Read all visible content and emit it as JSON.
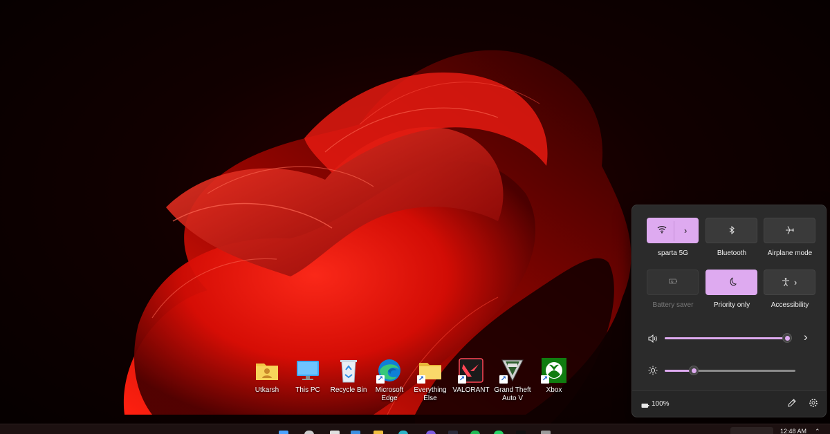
{
  "desktop": {
    "icons": [
      {
        "label": "Utkarsh",
        "icon": "user-folder-icon",
        "shortcut": false
      },
      {
        "label": "This PC",
        "icon": "monitor-icon",
        "shortcut": false
      },
      {
        "label": "Recycle Bin",
        "icon": "recycle-bin-icon",
        "shortcut": false
      },
      {
        "label": "Microsoft Edge",
        "icon": "edge-icon",
        "shortcut": true
      },
      {
        "label": "Everything Else",
        "icon": "folder-icon",
        "shortcut": true
      },
      {
        "label": "VALORANT",
        "icon": "valorant-icon",
        "shortcut": true
      },
      {
        "label": "Grand Theft Auto V",
        "icon": "gta-v-icon",
        "shortcut": true
      },
      {
        "label": "Xbox",
        "icon": "xbox-icon",
        "shortcut": true
      }
    ]
  },
  "quick_settings": {
    "tiles": [
      {
        "label": "sparta 5G",
        "icon": "wifi-icon",
        "active": true,
        "has_arrow": true
      },
      {
        "label": "Bluetooth",
        "icon": "bluetooth-icon",
        "active": false,
        "has_arrow": false
      },
      {
        "label": "Airplane mode",
        "icon": "airplane-icon",
        "active": false,
        "has_arrow": false
      },
      {
        "label": "Battery saver",
        "icon": "battery-saver-icon",
        "active": false,
        "disabled": true,
        "has_arrow": false
      },
      {
        "label": "Priority only",
        "icon": "moon-icon",
        "active": true,
        "has_arrow": false
      },
      {
        "label": "Accessibility",
        "icon": "accessibility-icon",
        "active": false,
        "has_arrow": true
      }
    ],
    "volume": {
      "icon": "speaker-icon",
      "level": 0.96
    },
    "brightness": {
      "icon": "sun-icon",
      "level": 0.22
    },
    "battery": {
      "icon": "battery-icon",
      "text": "100%"
    },
    "accent_color": "#deaaf0"
  },
  "taskbar": {
    "clock": "12:48 AM"
  }
}
